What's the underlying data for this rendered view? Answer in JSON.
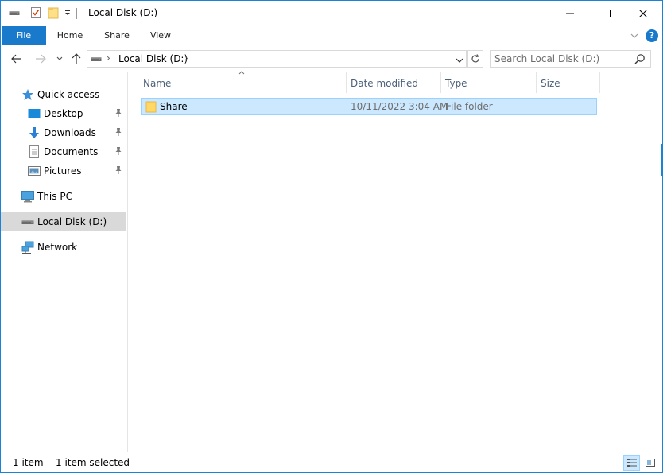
{
  "window": {
    "title": "Local Disk (D:)",
    "accent_color": "#1979ca"
  },
  "title_bar": {
    "quick_access_toolbar": [
      "drive-icon",
      "properties-icon",
      "new-folder-icon",
      "customize-dropdown-icon"
    ],
    "buttons": [
      "minimize-icon",
      "maximize-icon",
      "close-icon"
    ]
  },
  "ribbon": {
    "tabs": [
      {
        "label": "File",
        "active": true
      },
      {
        "label": "Home"
      },
      {
        "label": "Share"
      },
      {
        "label": "View"
      }
    ],
    "help_label": "?"
  },
  "address_bar": {
    "path": "Local Disk (D:)",
    "separator": "›"
  },
  "search": {
    "placeholder": "Search Local Disk (D:)"
  },
  "nav_pane": {
    "items": [
      {
        "label": "Quick access",
        "icon": "star-icon"
      },
      {
        "label": "Desktop",
        "icon": "desktop-icon",
        "pinned": true
      },
      {
        "label": "Downloads",
        "icon": "download-icon",
        "pinned": true
      },
      {
        "label": "Documents",
        "icon": "documents-icon",
        "pinned": true
      },
      {
        "label": "Pictures",
        "icon": "pictures-icon",
        "pinned": true
      },
      {
        "label": "This PC",
        "icon": "computer-icon"
      },
      {
        "label": "Local Disk (D:)",
        "icon": "drive-icon",
        "selected": true
      },
      {
        "label": "Network",
        "icon": "network-icon"
      }
    ]
  },
  "file_list": {
    "columns": [
      "Name",
      "Date modified",
      "Type",
      "Size"
    ],
    "rows": [
      {
        "name": "Share",
        "date_modified": "10/11/2022 3:04 AM",
        "type": "File folder",
        "size": "",
        "selected": true
      }
    ]
  },
  "status_bar": {
    "item_count": "1 item",
    "selection": "1 item selected"
  }
}
